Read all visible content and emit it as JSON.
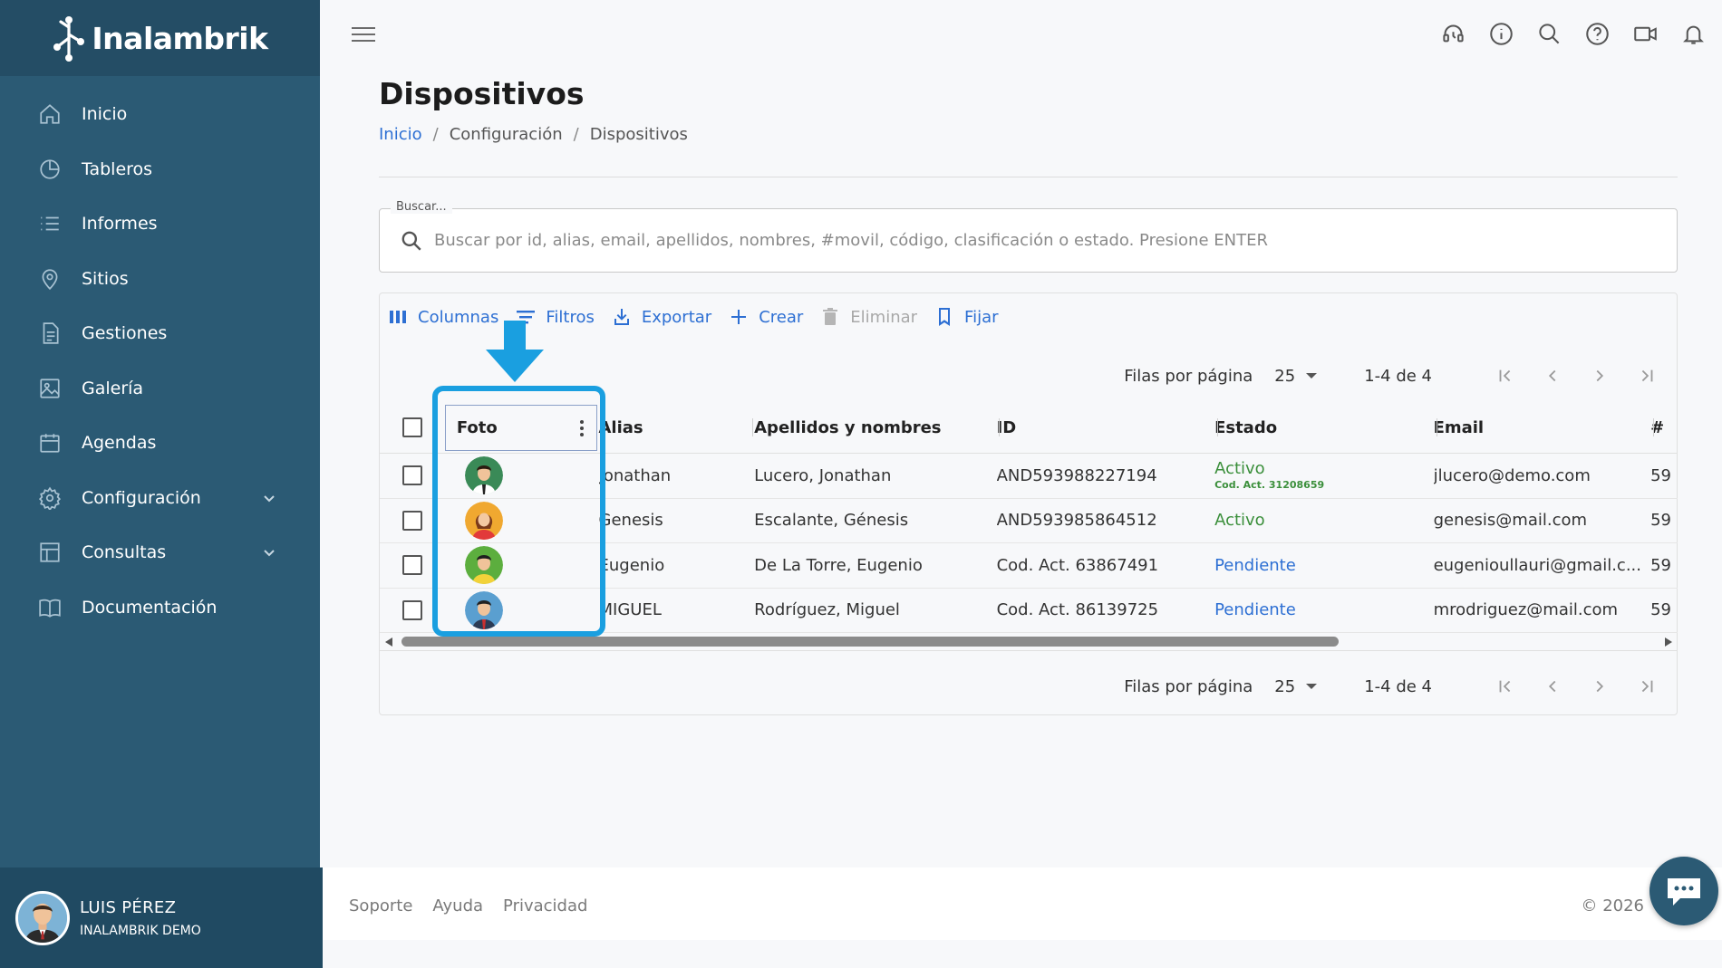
{
  "brand": {
    "name": "Inalambrik"
  },
  "sidebar": {
    "items": [
      {
        "label": "Inicio",
        "icon": "home-icon"
      },
      {
        "label": "Tableros",
        "icon": "pie-chart-icon"
      },
      {
        "label": "Informes",
        "icon": "list-icon"
      },
      {
        "label": "Sitios",
        "icon": "location-pin-icon"
      },
      {
        "label": "Gestiones",
        "icon": "document-icon"
      },
      {
        "label": "Galería",
        "icon": "image-icon"
      },
      {
        "label": "Agendas",
        "icon": "calendar-icon"
      },
      {
        "label": "Configuración",
        "icon": "gear-icon",
        "expandable": true
      },
      {
        "label": "Consultas",
        "icon": "table-icon",
        "expandable": true
      },
      {
        "label": "Documentación",
        "icon": "book-icon"
      }
    ]
  },
  "user": {
    "name": "LUIS PÉREZ",
    "org": "INALAMBRIK DEMO"
  },
  "header": {
    "icons": [
      "support-headset-icon",
      "info-icon",
      "search-icon",
      "help-icon",
      "video-camera-icon",
      "bell-icon"
    ]
  },
  "page": {
    "title": "Dispositivos",
    "breadcrumb": {
      "home": "Inicio",
      "sep": "/",
      "section": "Configuración",
      "current": "Dispositivos"
    }
  },
  "search": {
    "legend": "Buscar...",
    "placeholder": "Buscar por id, alias, email, apellidos, nombres, #movil, código, clasificación o estado. Presione ENTER",
    "value": ""
  },
  "toolbar": {
    "columns": "Columnas",
    "filters": "Filtros",
    "export": "Exportar",
    "create": "Crear",
    "delete": "Eliminar",
    "pin": "Fijar"
  },
  "pager": {
    "rows_label": "Filas por página",
    "rows_value": "25",
    "range": "1-4 de 4"
  },
  "table": {
    "columns": {
      "foto": "Foto",
      "alias": "Alias",
      "nombre": "Apellidos y nombres",
      "id": "ID",
      "estado": "Estado",
      "email": "Email",
      "num": "#"
    },
    "rows": [
      {
        "alias": "Jonathan",
        "nombre": "Lucero, Jonathan",
        "id": "AND593988227194",
        "estado": "Activo",
        "estado_sub": "Cod. Act. 31208659",
        "email": "jlucero@demo.com",
        "num": "59",
        "avatar": "green"
      },
      {
        "alias": "Genesis",
        "nombre": "Escalante, Génesis",
        "id": "AND593985864512",
        "estado": "Activo",
        "estado_sub": "",
        "email": "genesis@mail.com",
        "num": "59",
        "avatar": "orange"
      },
      {
        "alias": "Eugenio",
        "nombre": "De La Torre, Eugenio",
        "id": "Cod. Act. 63867491",
        "estado": "Pendiente",
        "estado_sub": "",
        "email": "eugenioullauri@gmail.c...",
        "num": "59",
        "avatar": "lime"
      },
      {
        "alias": "MIGUEL",
        "nombre": "Rodríguez, Miguel",
        "id": "Cod. Act. 86139725",
        "estado": "Pendiente",
        "estado_sub": "",
        "email": "mrodriguez@mail.com",
        "num": "59",
        "avatar": "blue"
      }
    ]
  },
  "footer": {
    "links": [
      "Soporte",
      "Ayuda",
      "Privacidad"
    ],
    "copyright": "© 2026"
  },
  "colors": {
    "sidebar": "#2b5a74",
    "accent": "#2d6fd3",
    "active": "#3b8f3b",
    "highlight": "#1a9fe0"
  }
}
